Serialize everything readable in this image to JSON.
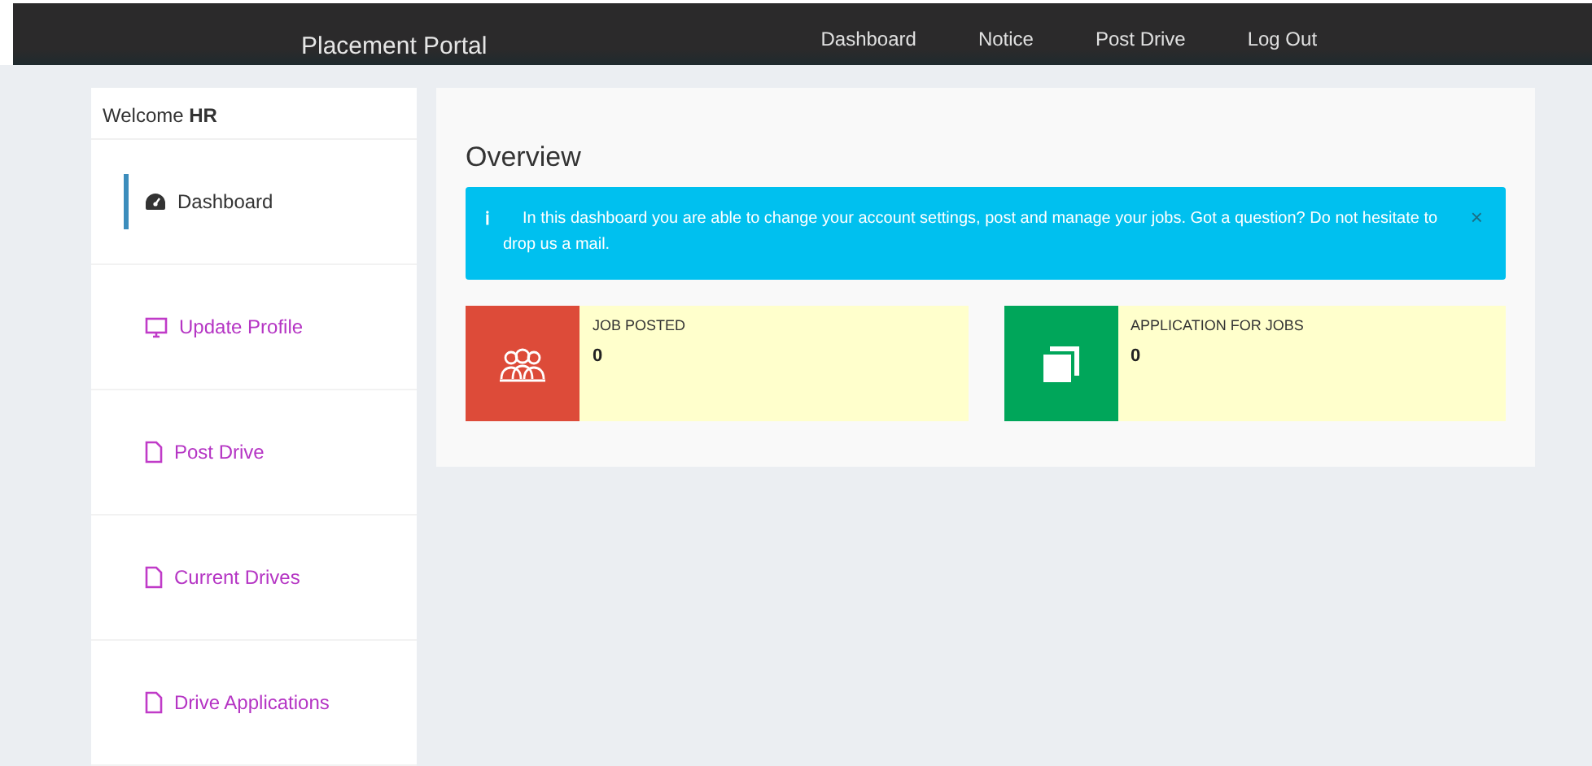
{
  "navbar": {
    "brand": "Placement Portal",
    "links": [
      "Dashboard",
      "Notice",
      "Post Drive",
      "Log Out"
    ]
  },
  "sidebar": {
    "welcome": "Welcome **HR**",
    "items": [
      {
        "label": "Dashboard",
        "kind": "dashboard",
        "selected": true
      },
      {
        "label": "Update Profile",
        "kind": "monitor",
        "selected": false
      },
      {
        "label": "Post Drive",
        "kind": "file",
        "selected": false
      },
      {
        "label": "Current Drives",
        "kind": "file",
        "selected": false
      },
      {
        "label": "Drive Applications",
        "kind": "file",
        "selected": false
      }
    ]
  },
  "main": {
    "title": "Overview",
    "alert": {
      "icon": "ℹ",
      "text": "In this dashboard you are able to change your account settings, post and manage your jobs. Got a question? Do not hesitate to drop us a mail.",
      "close": "×"
    },
    "stats": [
      {
        "label": "JOB POSTED",
        "value": "0",
        "kind": "users",
        "color": "#dd4b39"
      },
      {
        "label": "APPLICATION FOR JOBS",
        "value": "0",
        "kind": "copy",
        "color": "#00a65a"
      }
    ]
  }
}
